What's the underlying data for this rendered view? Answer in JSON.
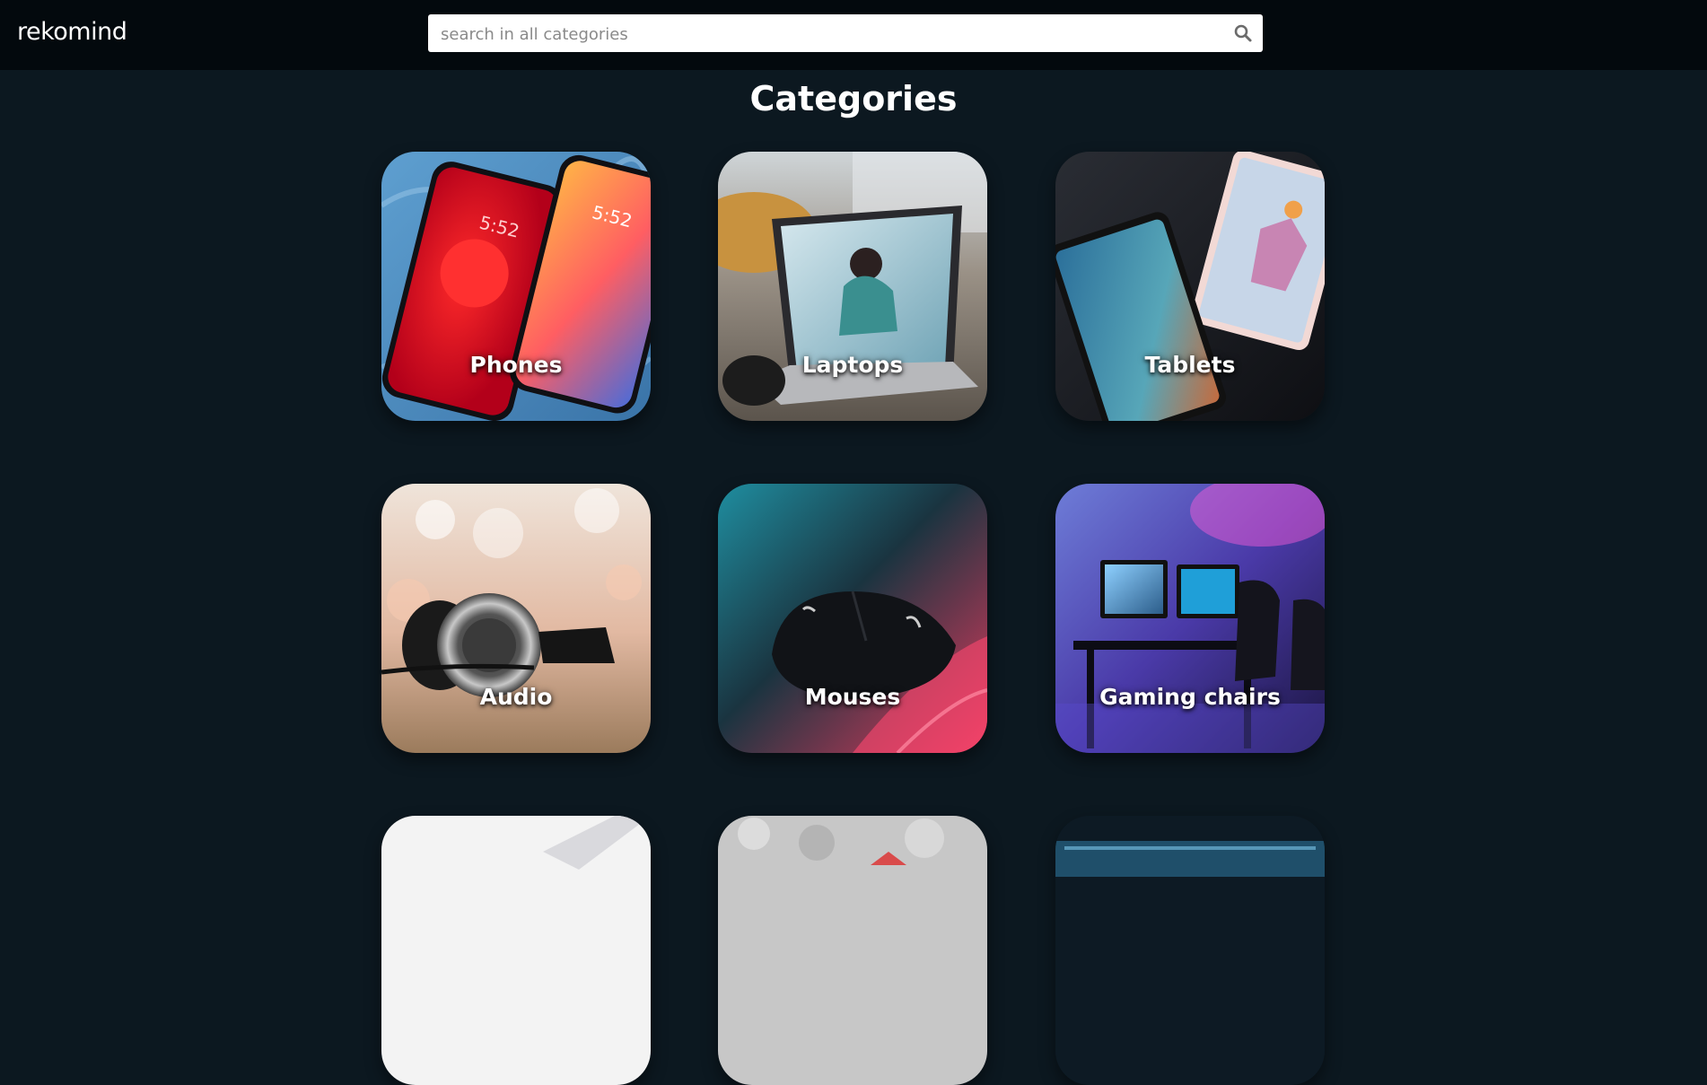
{
  "header": {
    "logo": "rekomind",
    "search": {
      "placeholder": "search in all categories",
      "value": ""
    }
  },
  "main": {
    "title": "Categories",
    "categories": [
      {
        "label": "Phones",
        "image": "two-smartphones-photo"
      },
      {
        "label": "Laptops",
        "image": "laptop-photo"
      },
      {
        "label": "Tablets",
        "image": "two-tablets-photo"
      },
      {
        "label": "Audio",
        "image": "headphones-photo"
      },
      {
        "label": "Mouses",
        "image": "gaming-mouse-photo"
      },
      {
        "label": "Gaming chairs",
        "image": "gaming-setup-photo"
      }
    ]
  },
  "icons": {
    "search": "search-icon"
  },
  "colors": {
    "background": "#0c1820",
    "header": "#03090d",
    "accent_text": "#ffffff"
  }
}
